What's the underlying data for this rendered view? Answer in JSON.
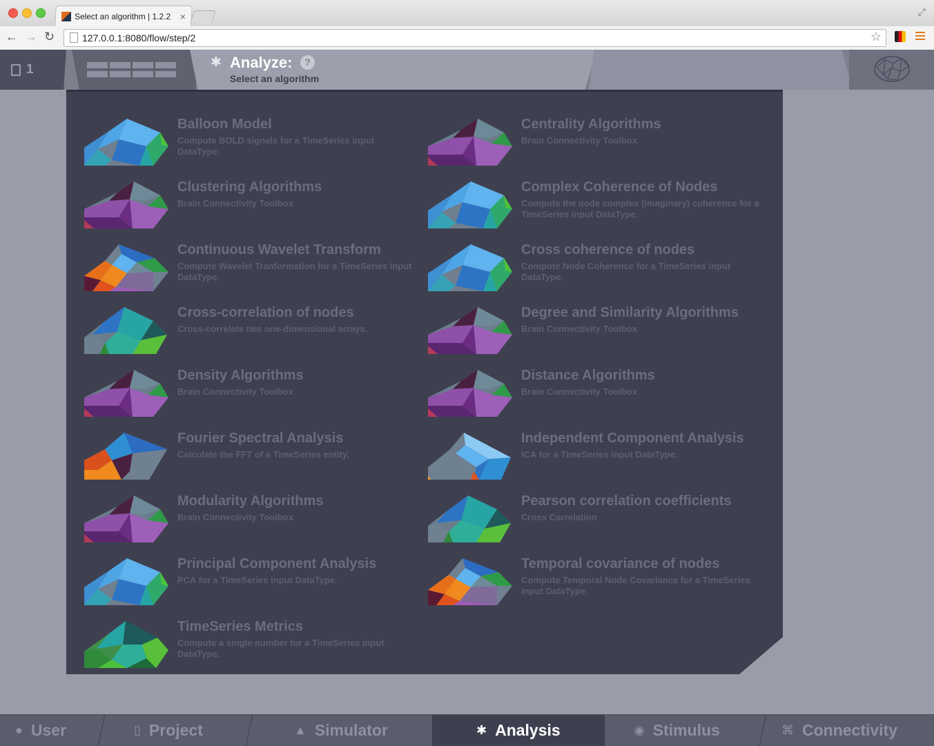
{
  "browser": {
    "tab_title": "Select an algorithm | 1.2.2",
    "url": "127.0.0.1:8080/flow/step/2"
  },
  "header": {
    "project_count": "1",
    "step_title": "Analyze:",
    "step_help": "?",
    "step_subtitle": "Select an algorithm"
  },
  "algorithms": [
    {
      "title": "Balloon Model",
      "desc": "Compute BOLD signals for a TimeSeries input DataType.",
      "icon": "blue-polygon"
    },
    {
      "title": "Centrality Algorithms",
      "desc": "Brain Connectivity Toolbox",
      "icon": "purple-polygon"
    },
    {
      "title": "Clustering Algorithms",
      "desc": "Brain Connectivity Toolbox",
      "icon": "purple-polygon"
    },
    {
      "title": "Complex Coherence of Nodes",
      "desc": "Compute the node complex (imaginary) coherence for a TimeSeries input DataType.",
      "icon": "blue-polygon"
    },
    {
      "title": "Continuous Wavelet Transform",
      "desc": "Compute Wavelet Tranformation for a TimeSeries input DataType.",
      "icon": "mixed-polygon"
    },
    {
      "title": "Cross coherence of nodes",
      "desc": "Compute Node Coherence for a TimeSeries input DataType.",
      "icon": "blue-polygon"
    },
    {
      "title": "Cross-correlation of nodes",
      "desc": "Cross-correlate two one-dimensional arrays.",
      "icon": "teal-polygon"
    },
    {
      "title": "Degree and Similarity Algorithms",
      "desc": "Brain Connectivity Toolbox",
      "icon": "purple-polygon"
    },
    {
      "title": "Density Algorithms",
      "desc": "Brain Connectivity Toolbox",
      "icon": "purple-polygon"
    },
    {
      "title": "Distance Algorithms",
      "desc": "Brain Connectivity Toolbox",
      "icon": "purple-polygon"
    },
    {
      "title": "Fourier Spectral Analysis",
      "desc": "Calculate the FFT of a TimeSeries entity.",
      "icon": "orange-polygon"
    },
    {
      "title": "Independent Component Analysis",
      "desc": "ICA for a TimeSeries input DataType.",
      "icon": "gray-blue-polygon"
    },
    {
      "title": "Modularity Algorithms",
      "desc": "Brain Connectivity Toolbox",
      "icon": "purple-polygon"
    },
    {
      "title": "Pearson correlation coefficients",
      "desc": "Cross Correlation",
      "icon": "teal-polygon"
    },
    {
      "title": "Principal Component Analysis",
      "desc": "PCA for a TimeSeries input DataType.",
      "icon": "blue-polygon"
    },
    {
      "title": "Temporal covariance of nodes",
      "desc": "Compute Temporal Node Covariance for a TimeSeries input DataType.",
      "icon": "mixed-polygon"
    },
    {
      "title": "TimeSeries Metrics",
      "desc": "Compute a single number for a TimeSeries input DataType.",
      "icon": "green-polygon"
    }
  ],
  "bottom_nav": [
    {
      "label": "User",
      "icon": "user-icon",
      "active": false
    },
    {
      "label": "Project",
      "icon": "document-icon",
      "active": false
    },
    {
      "label": "Simulator",
      "icon": "rocket-icon",
      "active": false
    },
    {
      "label": "Analysis",
      "icon": "gear-icon",
      "active": true
    },
    {
      "label": "Stimulus",
      "icon": "pin-icon",
      "active": false
    },
    {
      "label": "Connectivity",
      "icon": "connectivity-icon",
      "active": false
    }
  ],
  "colors": {
    "panel": "#3e4050",
    "page_bg": "#9a9ca8",
    "title_text": "#6b6d7c",
    "active_nav": "#3e4050"
  }
}
